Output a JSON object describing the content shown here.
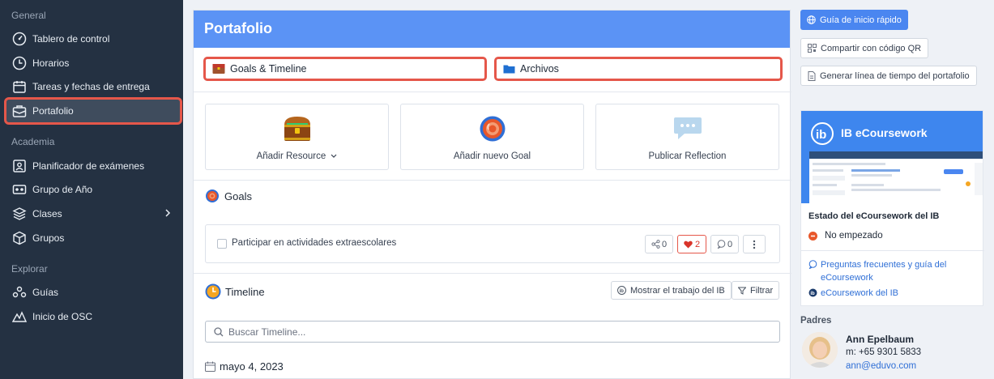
{
  "sidebar": {
    "sections": {
      "general": "General",
      "academia": "Academia",
      "explorar": "Explorar"
    },
    "items": [
      {
        "label": "Tablero de control",
        "icon": "dashboard-icon"
      },
      {
        "label": "Horarios",
        "icon": "clock-icon"
      },
      {
        "label": "Tareas y fechas de entrega",
        "icon": "calendar-icon"
      },
      {
        "label": "Portafolio",
        "icon": "briefcase-icon",
        "active": true
      },
      {
        "label": "Planificador de exámenes",
        "icon": "exam-planner-icon"
      },
      {
        "label": "Grupo de Año",
        "icon": "year-group-icon"
      },
      {
        "label": "Clases",
        "icon": "classes-icon"
      },
      {
        "label": "Grupos",
        "icon": "groups-icon"
      },
      {
        "label": "Guías",
        "icon": "guides-icon"
      },
      {
        "label": "Inicio de OSC",
        "icon": "osc-icon"
      }
    ]
  },
  "main": {
    "title": "Portafolio",
    "tabs": [
      {
        "label": "Goals & Timeline"
      },
      {
        "label": "Archivos"
      }
    ],
    "actions": [
      {
        "label": "Añadir Resource"
      },
      {
        "label": "Añadir nuevo Goal"
      },
      {
        "label": "Publicar Reflection"
      }
    ],
    "goals": {
      "title": "Goals",
      "item": {
        "text": "Participar en actividades extraescolares",
        "shares": "0",
        "likes": "2",
        "comments": "0"
      }
    },
    "timeline": {
      "title": "Timeline",
      "show_ib_label": "Mostrar el trabajo del IB",
      "filter_label": "Filtrar",
      "search_placeholder": "Buscar Timeline...",
      "date": "mayo 4, 2023"
    }
  },
  "right": {
    "quick_start": "Guía de inicio rápido",
    "share_qr": "Compartir con código QR",
    "generate_timeline": "Generar línea de tiempo del portafolio",
    "ib": {
      "title": "IB eCoursework",
      "status_title": "Estado del eCoursework del IB",
      "status": "No empezado",
      "faq_link": "Preguntas frecuentes y guía del eCoursework",
      "ib_link": "eCoursework del IB"
    },
    "parents": {
      "heading": "Padres",
      "name": "Ann Epelbaum",
      "phone": "m: +65 9301 5833",
      "email": "ann@eduvo.com"
    }
  },
  "colors": {
    "sidebar_bg": "#243142",
    "header_blue": "#5b93f5",
    "highlight_red": "#e5574a",
    "link_blue": "#2f6fd6"
  }
}
